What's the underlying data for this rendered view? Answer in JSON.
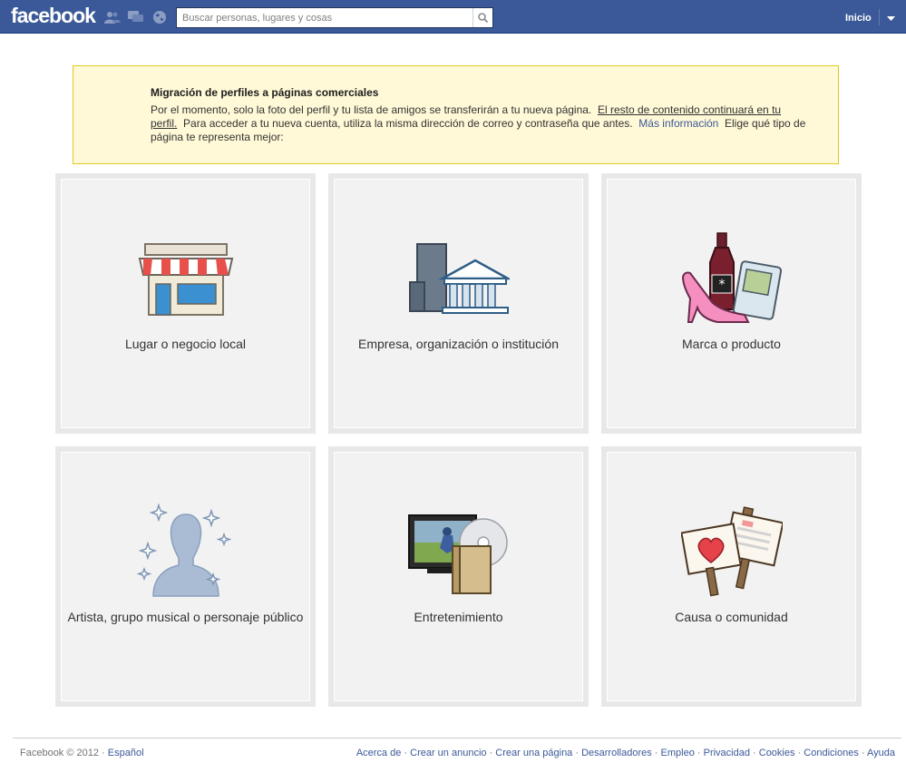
{
  "header": {
    "logo": "facebook",
    "search_placeholder": "Buscar personas, lugares y cosas",
    "home_label": "Inicio",
    "brand_color": "#3b5998"
  },
  "notice": {
    "title": "Migración de perfiles a páginas comerciales",
    "text_1": "Por el momento, solo la foto del perfil y tu lista de amigos se transferirán a tu nueva página.",
    "text_underlined": "El resto de contenido continuará en tu perfil.",
    "text_2": "Para acceder a tu nueva cuenta, utiliza la misma dirección de correo y contraseña que antes.",
    "more_info": "Más información",
    "text_3": "Elige qué tipo de página te representa mejor:"
  },
  "categories": [
    {
      "label": "Lugar o negocio local",
      "icon": "storefront-icon"
    },
    {
      "label": "Empresa, organización o institución",
      "icon": "buildings-icon"
    },
    {
      "label": "Marca o producto",
      "icon": "products-icon"
    },
    {
      "label": "Artista, grupo musical o personaje público",
      "icon": "artist-silhouette-icon"
    },
    {
      "label": "Entretenimiento",
      "icon": "entertainment-icon"
    },
    {
      "label": "Causa o comunidad",
      "icon": "protest-signs-icon"
    }
  ],
  "footer": {
    "copyright": "Facebook © 2012 ·",
    "language": "Español",
    "links": [
      "Acerca de",
      "Crear un anuncio",
      "Crear una página",
      "Desarrolladores",
      "Empleo",
      "Privacidad",
      "Cookies",
      "Condiciones",
      "Ayuda"
    ]
  }
}
